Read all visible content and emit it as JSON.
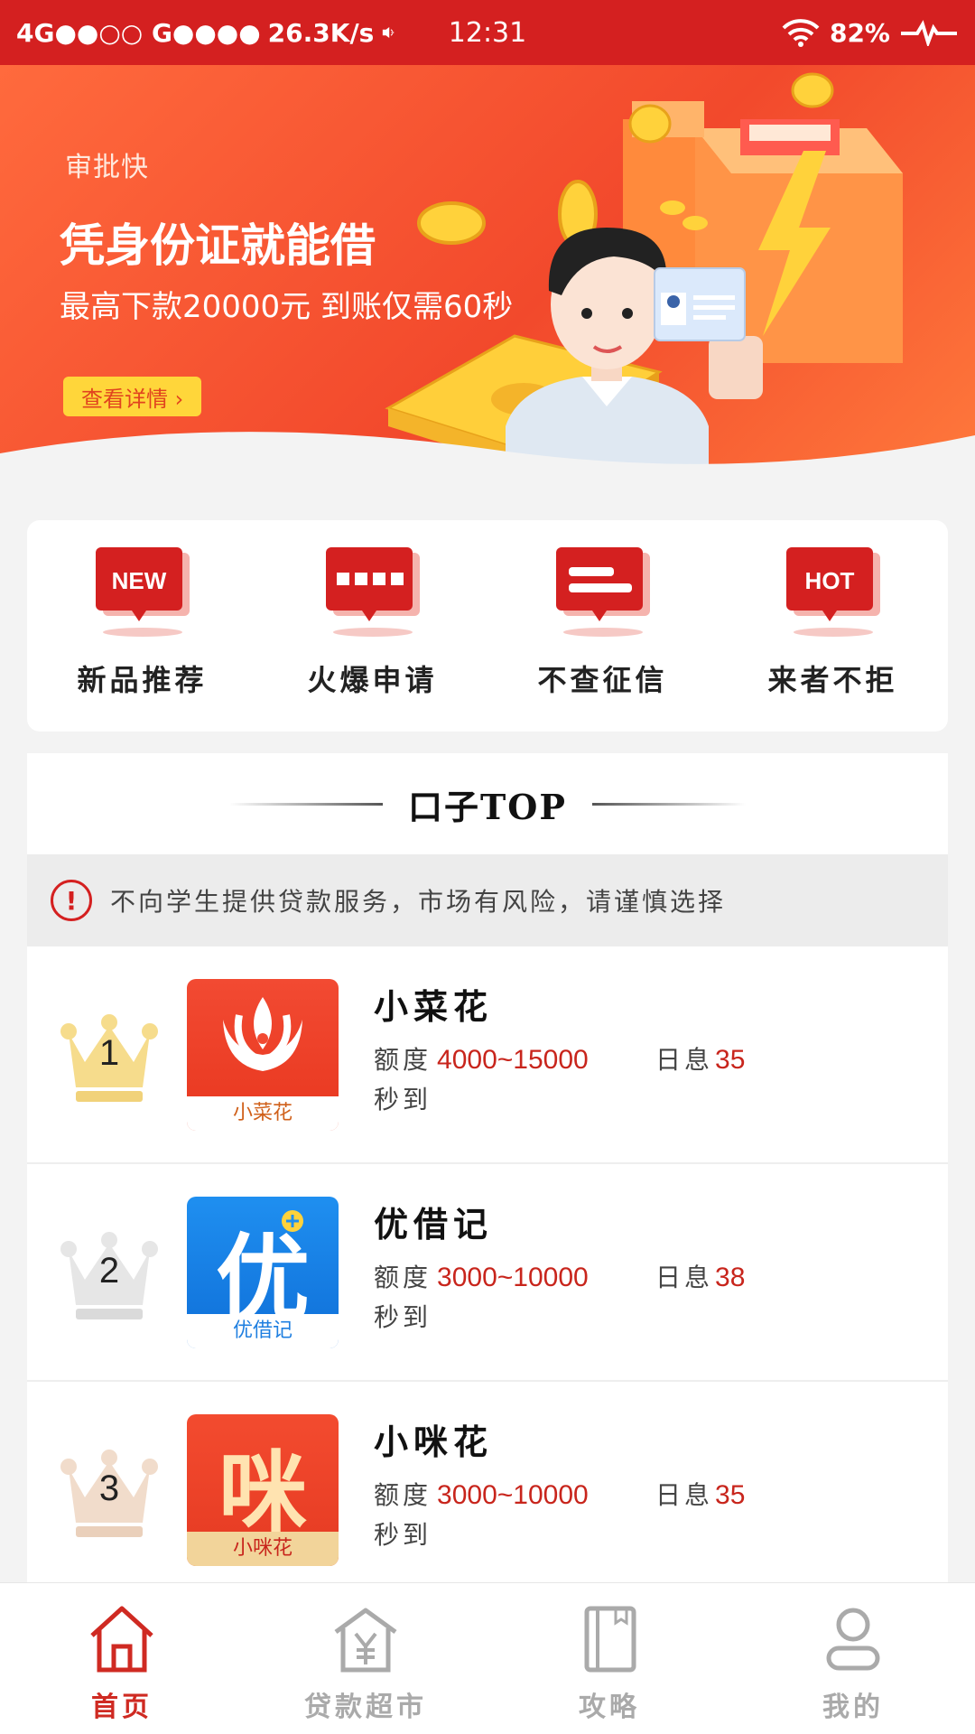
{
  "status_bar": {
    "network": "4G●●○○ G●●●●",
    "speed": "26.3K/s",
    "time": "12:31",
    "battery": "82%"
  },
  "banner": {
    "brand": "审批快",
    "title": "凭身份证就能借",
    "subtitle": "最高下款20000元 到账仅需60秒",
    "button": "查看详情 ›"
  },
  "categories": [
    {
      "label": "新品推荐",
      "icon_text": "NEW"
    },
    {
      "label": "火爆申请",
      "icon_text": ""
    },
    {
      "label": "不查征信",
      "icon_text": ""
    },
    {
      "label": "来者不拒",
      "icon_text": "HOT"
    }
  ],
  "list": {
    "title": "口子TOP",
    "notice": "不向学生提供贷款服务，市场有风险，请谨慎选择",
    "items": [
      {
        "rank": "1",
        "name": "小菜花",
        "logo_caption": "小菜花",
        "limit_label": "额度",
        "limit": "4000~15000",
        "rate_label": "日息",
        "rate": "35",
        "speed": "秒到"
      },
      {
        "rank": "2",
        "name": "优借记",
        "logo_caption": "优借记",
        "logo_glyph": "优",
        "limit_label": "额度",
        "limit": "3000~10000",
        "rate_label": "日息",
        "rate": "38",
        "speed": "秒到"
      },
      {
        "rank": "3",
        "name": "小咪花",
        "logo_caption": "小咪花",
        "logo_glyph": "咪",
        "limit_label": "额度",
        "limit": "3000~10000",
        "rate_label": "日息",
        "rate": "35",
        "speed": "秒到"
      }
    ]
  },
  "bottom_nav": [
    {
      "label": "首页",
      "icon": "home-icon",
      "active": true
    },
    {
      "label": "贷款超市",
      "icon": "market-icon",
      "active": false
    },
    {
      "label": "攻略",
      "icon": "book-icon",
      "active": false
    },
    {
      "label": "我的",
      "icon": "user-icon",
      "active": false
    }
  ],
  "colors": {
    "brand_red": "#d42020",
    "banner_orange": "#f2492c",
    "value_red": "#c8251c",
    "inactive_gray": "#aaaaaa"
  }
}
